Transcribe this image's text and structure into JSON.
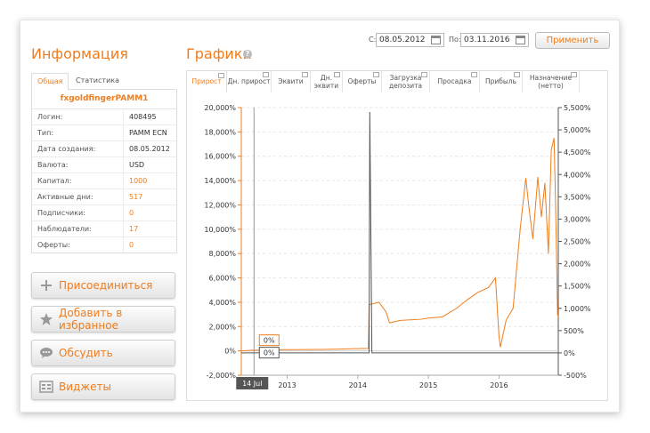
{
  "info": {
    "title": "Информация",
    "tabs": [
      "Общая",
      "Статистика"
    ],
    "account_name": "fxgoldfingerPAMM1",
    "rows": [
      {
        "label": "Логин:",
        "value": "408495",
        "accent": false
      },
      {
        "label": "Тип:",
        "value": "PAMM ECN",
        "accent": false
      },
      {
        "label": "Дата создания:",
        "value": "08.05.2012",
        "accent": false
      },
      {
        "label": "Валюта:",
        "value": "USD",
        "accent": false
      },
      {
        "label": "Капитал:",
        "value": "1000",
        "accent": true
      },
      {
        "label": "Активные дни:",
        "value": "517",
        "accent": true
      },
      {
        "label": "Подписчики:",
        "value": "0",
        "accent": true
      },
      {
        "label": "Наблюдатели:",
        "value": "17",
        "accent": true
      },
      {
        "label": "Оферты:",
        "value": "0",
        "accent": true
      }
    ]
  },
  "actions": {
    "join": "Присоединиться",
    "favorite": "Добавить в избранное",
    "discuss": "Обсудить",
    "widgets": "Виджеты"
  },
  "graphs": {
    "title": "Графики",
    "help": "?",
    "from_label": "С:",
    "from_date": "08.05.2012",
    "to_label": "По:",
    "to_date": "03.11.2016",
    "apply": "Применить",
    "tabs": [
      "Прирост",
      "Дн. прирост",
      "Эквити",
      "Дн. эквити",
      "Оферты",
      "Загрузка депозита",
      "Просадка",
      "Прибыль",
      "Назначение (нетто)"
    ]
  },
  "colors": {
    "accent": "#f07d1d",
    "secondary": "#555555"
  },
  "chart_data": {
    "type": "line",
    "x_tick_labels": [
      "2013",
      "2014",
      "2015",
      "2016"
    ],
    "cursor_label": "14 Jul",
    "left_axis_ticks": [
      "-2,000%",
      "0%",
      "2,000%",
      "4,000%",
      "6,000%",
      "8,000%",
      "10,000%",
      "12,000%",
      "14,000%",
      "16,000%",
      "18,000%",
      "20,000%"
    ],
    "right_axis_ticks": [
      "-500%",
      "0%",
      "500%",
      "1,000%",
      "1,500%",
      "2,000%",
      "2,500%",
      "3,000%",
      "3,500%",
      "4,000%",
      "4,500%",
      "5,000%",
      "5,500%"
    ],
    "ylim_left": [
      -2000,
      20000
    ],
    "ylim_right": [
      -500,
      5500
    ],
    "grid": true,
    "value_labels": [
      "0%",
      "0%"
    ],
    "series": [
      {
        "color": "#f07d1d",
        "axis": "left",
        "x": [
          2012.35,
          2012.5,
          2013.0,
          2013.5,
          2014.0,
          2014.15,
          2014.16,
          2014.3,
          2014.4,
          2014.45,
          2014.6,
          2014.9,
          2015.0,
          2015.2,
          2015.4,
          2015.55,
          2015.7,
          2015.85,
          2015.95,
          2016.0,
          2016.02,
          2016.1,
          2016.2,
          2016.3,
          2016.38,
          2016.42,
          2016.48,
          2016.55,
          2016.6,
          2016.65,
          2016.7,
          2016.74,
          2016.78,
          2016.8,
          2016.83,
          2016.84
        ],
        "y": [
          0,
          50,
          100,
          120,
          180,
          200,
          3800,
          4000,
          3200,
          2300,
          2500,
          2600,
          2700,
          2800,
          3500,
          4200,
          4800,
          5200,
          6000,
          1200,
          300,
          2500,
          3500,
          10000,
          14200,
          12000,
          9200,
          14300,
          11000,
          13800,
          8000,
          16500,
          17500,
          12500,
          3000,
          2800
        ]
      },
      {
        "color": "#555555",
        "axis": "right",
        "x": [
          2012.35,
          2013.0,
          2014.0,
          2014.16,
          2014.17,
          2014.2,
          2015.0,
          2016.0,
          2016.84
        ],
        "y": [
          0,
          0,
          0,
          0,
          5400,
          0,
          0,
          0,
          0
        ]
      }
    ]
  }
}
